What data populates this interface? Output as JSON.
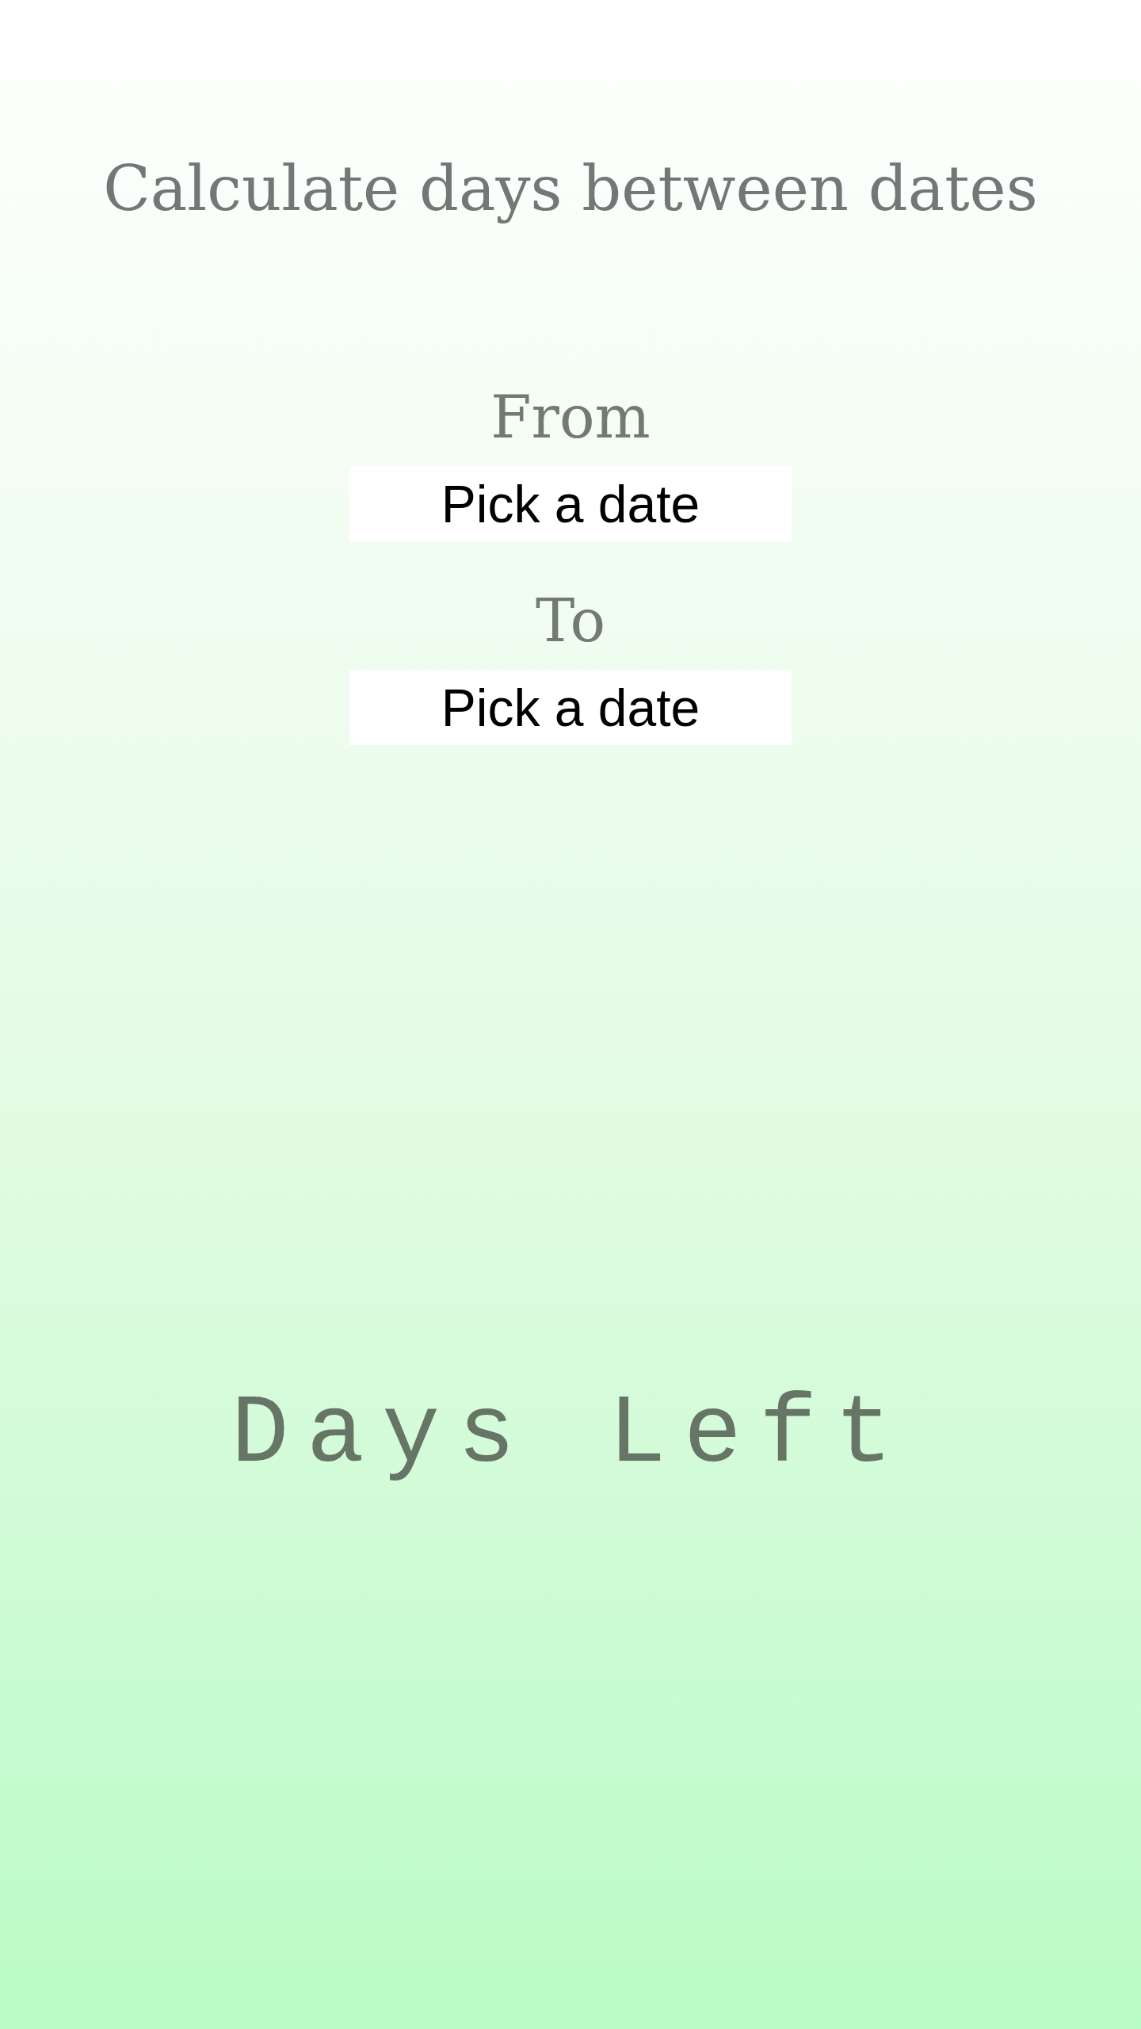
{
  "title": "Calculate days between dates",
  "fields": [
    {
      "label": "From",
      "button": "Pick a date"
    },
    {
      "label": "To",
      "button": "Pick a date"
    }
  ],
  "result": "Days Left"
}
